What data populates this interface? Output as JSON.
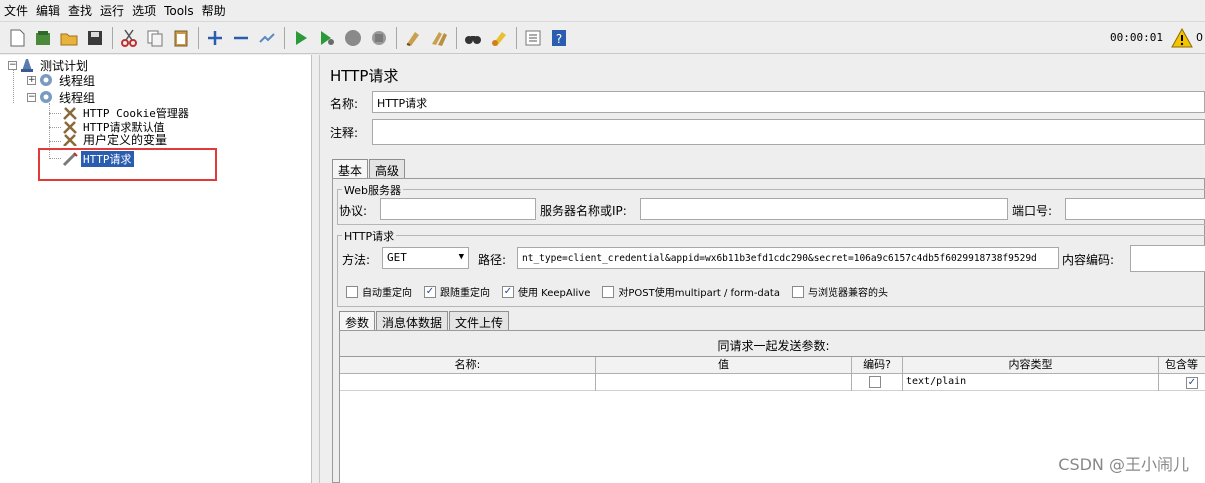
{
  "menu": [
    "文件",
    "编辑",
    "查找",
    "运行",
    "选项",
    "Tools",
    "帮助"
  ],
  "toolbar": {
    "icons": [
      "new-icon",
      "templates-icon",
      "open-icon",
      "save-icon",
      "cut-icon",
      "copy-icon",
      "paste-icon",
      "expand-icon",
      "collapse-icon",
      "toggle-icon",
      "start-icon",
      "start-no-pause-icon",
      "stop-icon",
      "shutdown-icon",
      "clear-icon",
      "clear-all-icon",
      "search-icon",
      "reset-search-icon",
      "function-helper-icon",
      "help-icon"
    ],
    "timer": "00:00:01",
    "warning_count": "0"
  },
  "tree": {
    "root": "测试计划",
    "group1": "线程组",
    "group2": "线程组",
    "cookie_manager": "HTTP Cookie管理器",
    "defaults": "HTTP请求默认值",
    "user_vars": "用户定义的变量",
    "http_request": "HTTP请求"
  },
  "panel": {
    "title": "HTTP请求",
    "name_label": "名称:",
    "name_value": "HTTP请求",
    "comment_label": "注释:",
    "comment_value": "",
    "tabs": [
      "基本",
      "高级"
    ],
    "web_server": {
      "title": "Web服务器",
      "protocol_label": "协议:",
      "protocol_value": "",
      "server_label": "服务器名称或IP:",
      "server_value": "",
      "port_label": "端口号:",
      "port_value": ""
    },
    "http_request": {
      "title": "HTTP请求",
      "method_label": "方法:",
      "method_value": "GET",
      "path_label": "路径:",
      "path_value": "nt_type=client_credential&appid=wx6b11b3efd1cdc290&secret=106a9c6157c4db5f6029918738f9529d",
      "encoding_label": "内容编码:",
      "encoding_value": ""
    },
    "checkboxes": [
      {
        "label": "自动重定向",
        "checked": false
      },
      {
        "label": "跟随重定向",
        "checked": true
      },
      {
        "label": "使用 KeepAlive",
        "checked": true
      },
      {
        "label": "对POST使用multipart / form-data",
        "checked": false
      },
      {
        "label": "与浏览器兼容的头",
        "checked": false
      }
    ],
    "sub_tabs": [
      "参数",
      "消息体数据",
      "文件上传"
    ],
    "params_caption": "同请求一起发送参数:",
    "columns": [
      "名称:",
      "值",
      "编码?",
      "内容类型",
      "包含等"
    ],
    "rows": [
      {
        "name": "",
        "value": "",
        "encode": false,
        "content_type": "text/plain",
        "include_equals": true
      }
    ]
  },
  "watermark": "CSDN @王小闹儿"
}
